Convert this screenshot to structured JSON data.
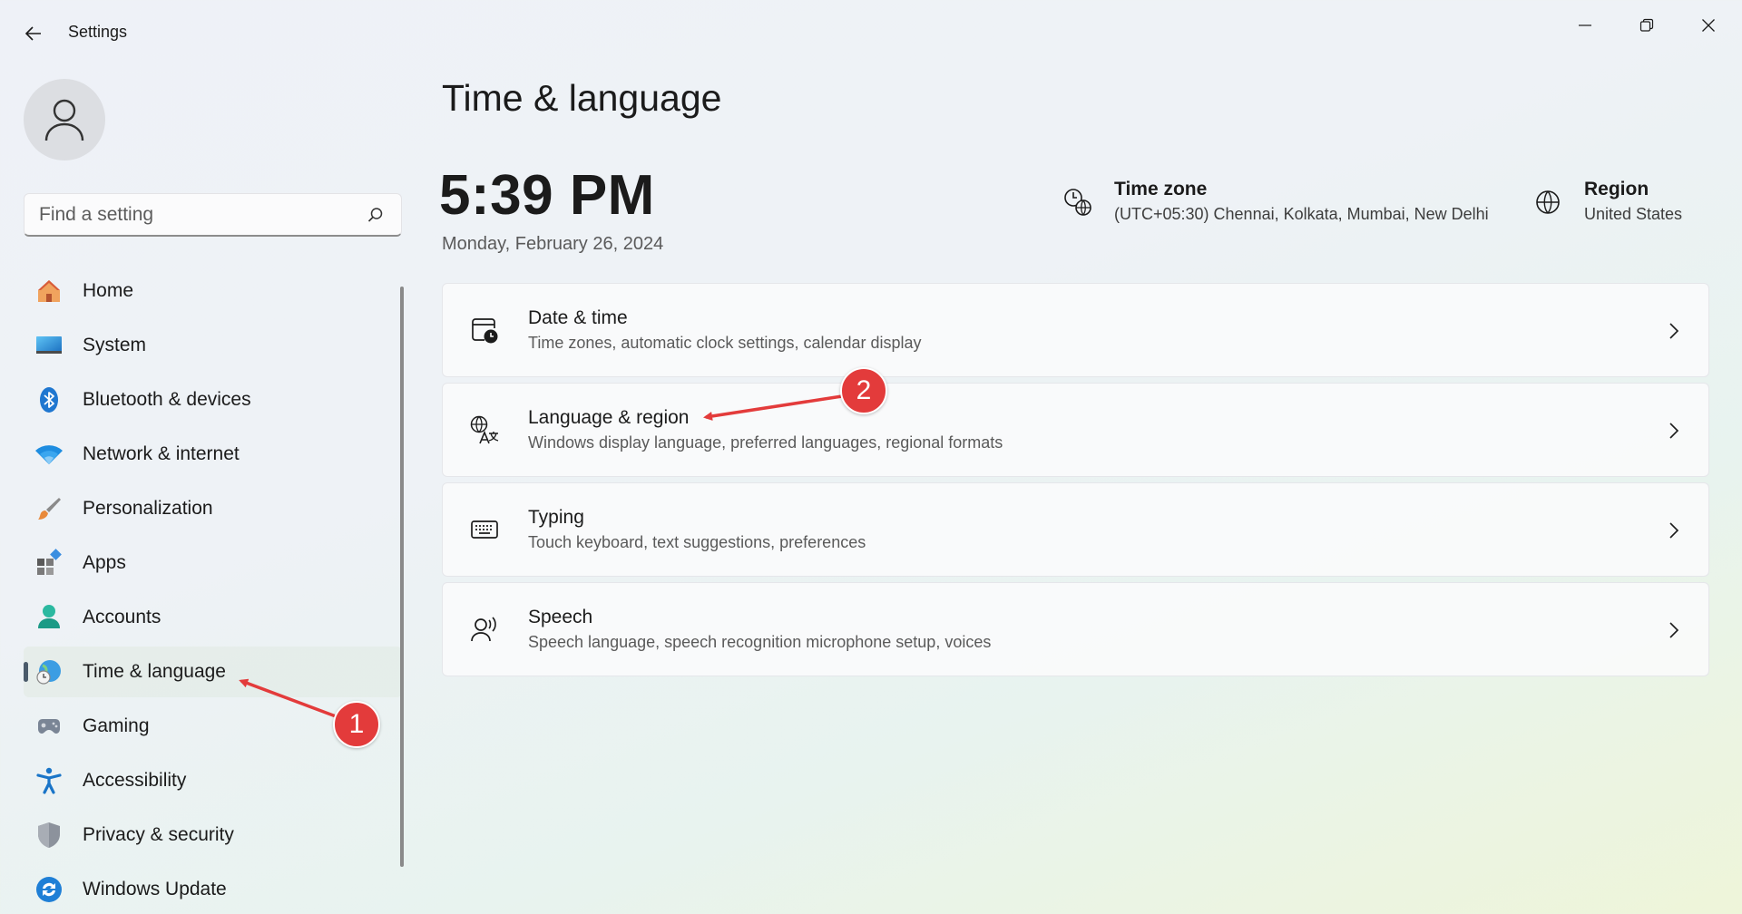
{
  "window": {
    "title": "Settings",
    "controls": [
      "minimize",
      "maximize",
      "close"
    ]
  },
  "search": {
    "placeholder": "Find a setting"
  },
  "sidebar": {
    "items": [
      {
        "label": "Home",
        "icon": "home-icon"
      },
      {
        "label": "System",
        "icon": "system-icon"
      },
      {
        "label": "Bluetooth & devices",
        "icon": "bluetooth-icon"
      },
      {
        "label": "Network & internet",
        "icon": "wifi-icon"
      },
      {
        "label": "Personalization",
        "icon": "brush-icon"
      },
      {
        "label": "Apps",
        "icon": "apps-icon"
      },
      {
        "label": "Accounts",
        "icon": "accounts-icon"
      },
      {
        "label": "Time & language",
        "icon": "globe-clock-icon",
        "selected": true
      },
      {
        "label": "Gaming",
        "icon": "gamepad-icon"
      },
      {
        "label": "Accessibility",
        "icon": "accessibility-icon"
      },
      {
        "label": "Privacy & security",
        "icon": "shield-icon"
      },
      {
        "label": "Windows Update",
        "icon": "update-icon"
      }
    ]
  },
  "main": {
    "title": "Time & language",
    "time": "5:39 PM",
    "date": "Monday, February 26, 2024",
    "timezone": {
      "title": "Time zone",
      "value": "(UTC+05:30) Chennai, Kolkata, Mumbai, New Delhi"
    },
    "region": {
      "title": "Region",
      "value": "United States"
    },
    "cards": [
      {
        "title": "Date & time",
        "desc": "Time zones, automatic clock settings, calendar display",
        "icon": "calendar-clock-icon"
      },
      {
        "title": "Language & region",
        "desc": "Windows display language, preferred languages, regional formats",
        "icon": "language-icon"
      },
      {
        "title": "Typing",
        "desc": "Touch keyboard, text suggestions, preferences",
        "icon": "keyboard-icon"
      },
      {
        "title": "Speech",
        "desc": "Speech language, speech recognition microphone setup, voices",
        "icon": "speech-icon"
      }
    ]
  },
  "annotations": {
    "badge1": "1",
    "badge2": "2",
    "color": "#e33b3b"
  }
}
